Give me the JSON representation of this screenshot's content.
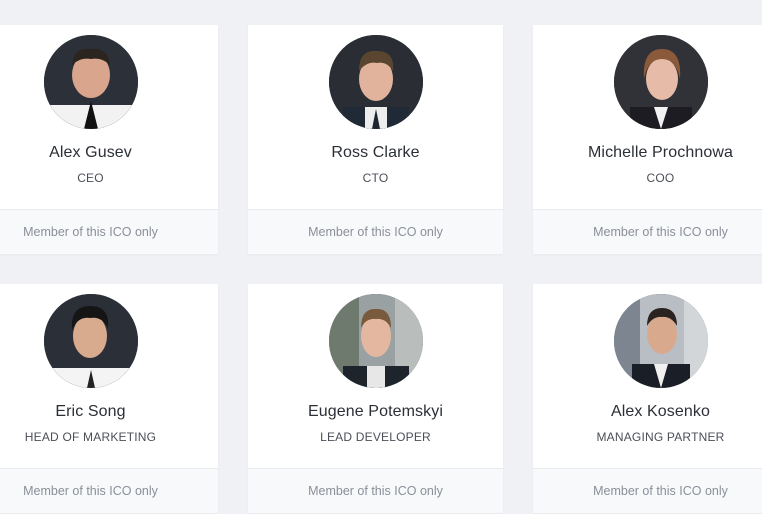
{
  "team": {
    "members": [
      {
        "name": "Alex Gusev",
        "role": "CEO",
        "note": "Member of this ICO only"
      },
      {
        "name": "Ross Clarke",
        "role": "CTO",
        "note": "Member of this ICO only"
      },
      {
        "name": "Michelle Prochnowa",
        "role": "COO",
        "note": "Member of this ICO only"
      },
      {
        "name": "Eric Song",
        "role": "HEAD OF MARKETING",
        "note": "Member of this ICO only"
      },
      {
        "name": "Eugene Potemskyi",
        "role": "LEAD DEVELOPER",
        "note": "Member of this ICO only"
      },
      {
        "name": "Alex Kosenko",
        "role": "MANAGING PARTNER",
        "note": "Member of this ICO only"
      }
    ]
  },
  "colors": {
    "page_background": "#f0f1f4",
    "card_background": "#ffffff",
    "footer_background": "#f8f9fb",
    "name_text": "#2b2f36",
    "footer_text": "#8a8f98"
  }
}
